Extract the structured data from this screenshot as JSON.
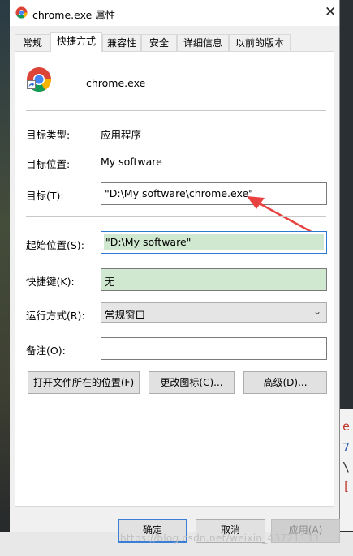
{
  "window": {
    "title": "chrome.exe 属性",
    "close_glyph": "✕"
  },
  "tabs": [
    "常规",
    "快捷方式",
    "兼容性",
    "安全",
    "详细信息",
    "以前的版本"
  ],
  "active_tab": "快捷方式",
  "shortcut": {
    "app_name": "chrome.exe",
    "target_type_label": "目标类型:",
    "target_type_value": "应用程序",
    "target_location_label": "目标位置:",
    "target_location_value": "My software",
    "target_label": "目标(T):",
    "target_value": "\"D:\\My software\\chrome.exe\"",
    "start_in_label": "起始位置(S):",
    "start_in_value": "\"D:\\My software\"",
    "hotkey_label": "快捷键(K):",
    "hotkey_value": "无",
    "run_label": "运行方式(R):",
    "run_value": "常规窗口",
    "comment_label": "备注(O):",
    "comment_value": "",
    "open_location_button": "打开文件所在的位置(F)",
    "change_icon_button": "更改图标(C)...",
    "advanced_button": "高级(D)..."
  },
  "footer": {
    "ok": "确定",
    "cancel": "取消",
    "apply": "应用(A)"
  },
  "background_chars": [
    "e",
    "7",
    "\\",
    "["
  ],
  "watermark": "https://blog.csdn.net/weixin_43721133",
  "colors": {
    "annotation_arrow": "#e8413f",
    "field_green": "#cfe8cf",
    "focus_blue": "#2b79d0"
  }
}
